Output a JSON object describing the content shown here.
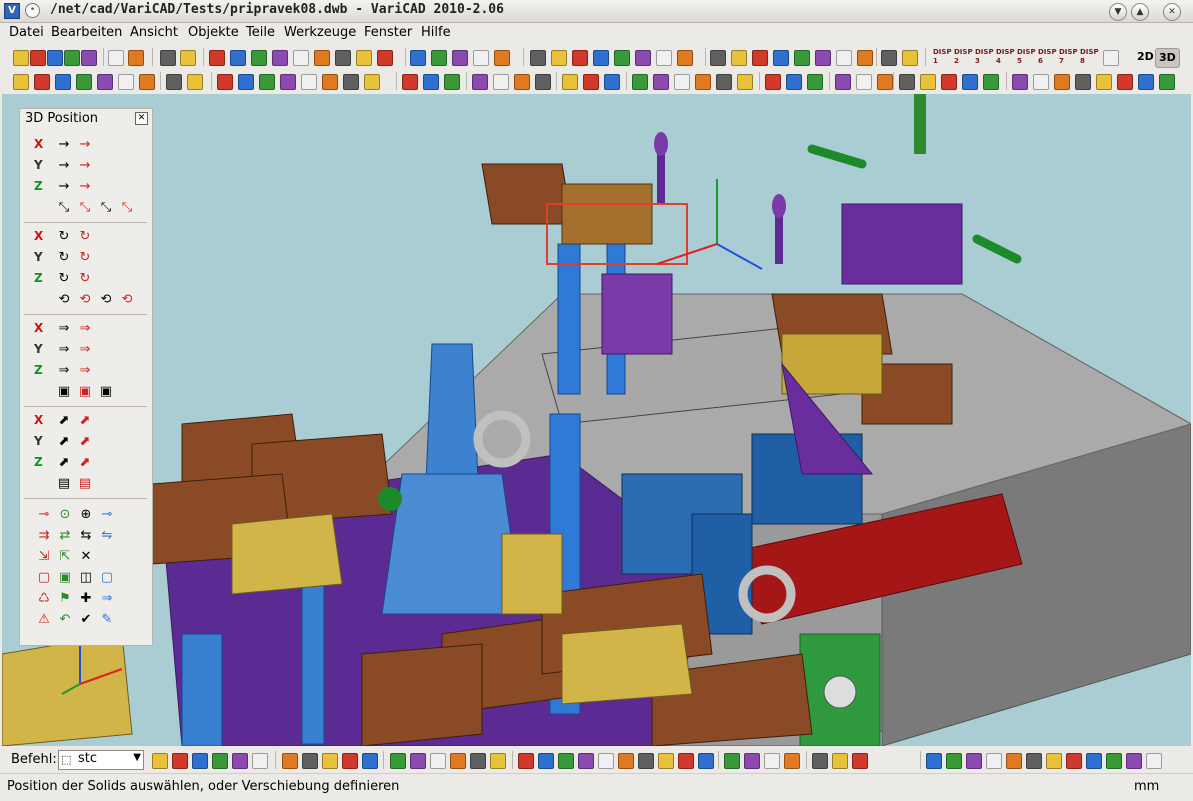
{
  "window": {
    "title": "/net/cad/VariCAD/Tests/pripravek08.dwb - VariCAD 2010-2.06",
    "minimize": "▼",
    "maximize": "▲",
    "close": "✕"
  },
  "menu": {
    "items": [
      "Datei",
      "Bearbeiten",
      "Ansicht",
      "Objekte",
      "Teile",
      "Werkzeuge",
      "Fenster",
      "Hilfe"
    ]
  },
  "toolbar": {
    "mode_2d": "2D",
    "mode_3d": "3D",
    "disp_labels": [
      "DISP 1",
      "DISP 2",
      "DISP 3",
      "DISP 4",
      "DISP 5",
      "DISP 6",
      "DISP 7",
      "DISP 8"
    ]
  },
  "panel": {
    "title": "3D Position",
    "close": "✕",
    "axes": {
      "x": "X",
      "y": "Y",
      "z": "Z"
    }
  },
  "command": {
    "label": "Befehl:",
    "value": "stc"
  },
  "status": {
    "message": "Position der Solids auswählen, oder Verschiebung definieren",
    "units": "mm"
  }
}
